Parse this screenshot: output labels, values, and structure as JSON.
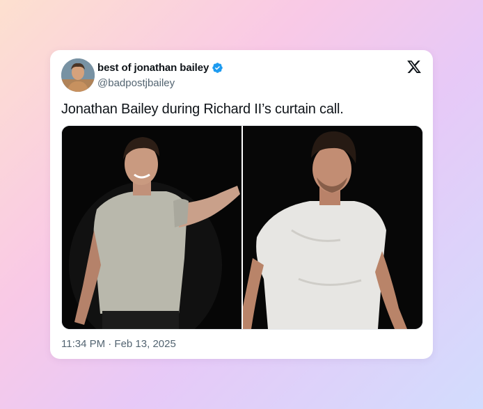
{
  "tweet": {
    "display_name": "best of jonathan bailey",
    "handle": "@badpostjbailey",
    "text": "Jonathan Bailey during Richard II’s curtain call.",
    "timestamp": "11:34 PM · Feb 13, 2025",
    "verified": true,
    "verified_color": "#1d9bf0",
    "icons": {
      "platform": "x-logo-icon",
      "badge": "verified-badge-icon"
    },
    "photos": [
      {
        "description": "man in grey t-shirt smiling, arm extended"
      },
      {
        "description": "man in white t-shirt looking down"
      }
    ]
  }
}
